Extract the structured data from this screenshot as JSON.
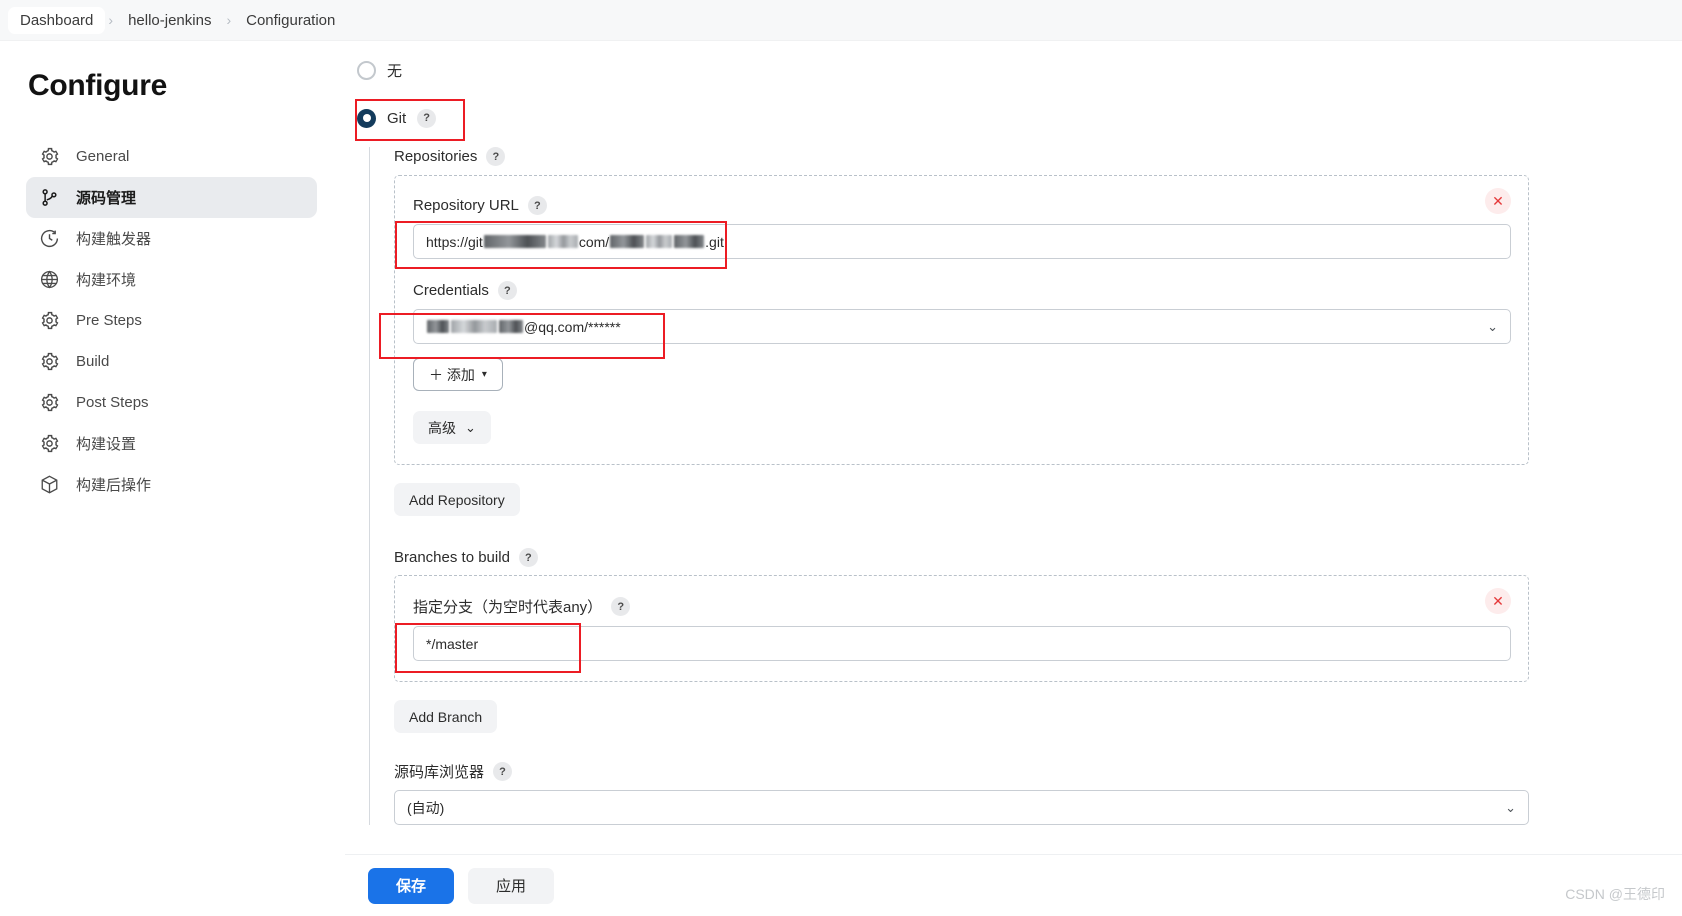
{
  "breadcrumb": {
    "items": [
      "Dashboard",
      "hello-jenkins",
      "Configuration"
    ],
    "separator": "›"
  },
  "sidebar": {
    "title": "Configure",
    "items": [
      {
        "label": "General",
        "icon": "gear-icon",
        "selected": false
      },
      {
        "label": "源码管理",
        "icon": "source-branch-icon",
        "selected": true
      },
      {
        "label": "构建触发器",
        "icon": "clock-icon",
        "selected": false
      },
      {
        "label": "构建环境",
        "icon": "globe-icon",
        "selected": false
      },
      {
        "label": "Pre Steps",
        "icon": "gear-icon",
        "selected": false
      },
      {
        "label": "Build",
        "icon": "gear-icon",
        "selected": false
      },
      {
        "label": "Post Steps",
        "icon": "gear-icon",
        "selected": false
      },
      {
        "label": "构建设置",
        "icon": "gear-icon",
        "selected": false
      },
      {
        "label": "构建后操作",
        "icon": "package-icon",
        "selected": false
      }
    ]
  },
  "scm": {
    "none_option_label": "无",
    "none_selected": false,
    "git_option_label": "Git",
    "git_selected": true,
    "help_glyph": "?",
    "repositories_label": "Repositories",
    "repository": {
      "url_label": "Repository URL",
      "url_prefix": "https://git",
      "url_mid": "com/",
      "url_suffix": ".git",
      "credentials_label": "Credentials",
      "credentials_value_suffix": "@qq.com/******",
      "add_credential_label": "＋ 添加",
      "add_credential_caret": "▾",
      "advanced_label": "高级",
      "advanced_caret": "⌄",
      "delete_glyph": "✕"
    },
    "add_repository_label": "Add Repository",
    "branches_label": "Branches to build",
    "branch": {
      "specifier_label": "指定分支（为空时代表any）",
      "specifier_value": "*/master",
      "delete_glyph": "✕"
    },
    "add_branch_label": "Add Branch",
    "browser_label": "源码库浏览器",
    "browser_value": "(自动)",
    "chevron_glyph": "⌄"
  },
  "footer": {
    "save_label": "保存",
    "apply_label": "应用"
  },
  "watermark": "CSDN @王德印",
  "colors": {
    "accent_blue": "#1a73e8",
    "radio_selected": "#133b5c",
    "annotation_red": "#ec1c24",
    "sidebar_selected_bg": "#e9ebee"
  }
}
